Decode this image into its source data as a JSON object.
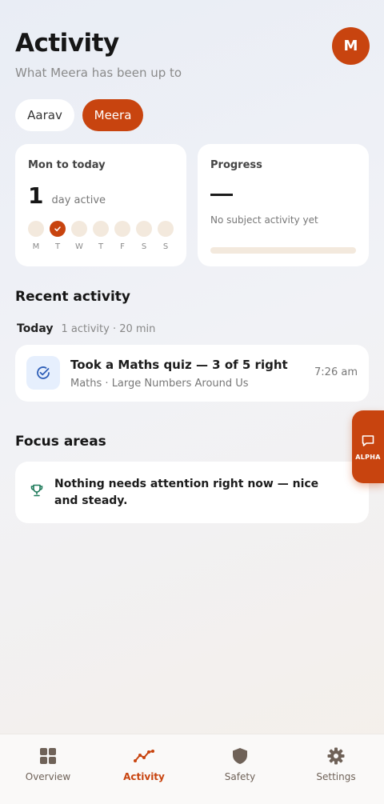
{
  "header": {
    "title": "Activity",
    "subtitle": "What Meera has been up to",
    "avatar_initial": "M"
  },
  "children": [
    {
      "name": "Aarav",
      "selected": false
    },
    {
      "name": "Meera",
      "selected": true
    }
  ],
  "week_card": {
    "label": "Mon to today",
    "days_active": "1",
    "days_active_text": "day active",
    "days": [
      {
        "letter": "M",
        "done": false
      },
      {
        "letter": "T",
        "done": true
      },
      {
        "letter": "W",
        "done": false
      },
      {
        "letter": "T",
        "done": false
      },
      {
        "letter": "F",
        "done": false
      },
      {
        "letter": "S",
        "done": false
      },
      {
        "letter": "S",
        "done": false
      }
    ]
  },
  "progress_card": {
    "label": "Progress",
    "note": "No subject activity yet",
    "fraction": 0
  },
  "recent": {
    "title": "Recent activity",
    "group_label": "Today",
    "group_meta": "1 activity · 20 min",
    "items": [
      {
        "title": "Took a Maths quiz — 3 of 5 right",
        "subtitle": "Maths · Large Numbers Around Us",
        "time": "7:26 am",
        "icon": "check-circle-icon"
      }
    ]
  },
  "focus": {
    "title": "Focus areas",
    "message": "Nothing needs attention right now — nice and steady.",
    "icon": "trophy-icon"
  },
  "alpha_button": {
    "label": "ALPHA",
    "icon": "chat-bubble-icon"
  },
  "nav": {
    "items": [
      {
        "label": "Overview",
        "icon": "grid-icon",
        "active": false
      },
      {
        "label": "Activity",
        "icon": "trend-icon",
        "active": true
      },
      {
        "label": "Safety",
        "icon": "shield-icon",
        "active": false
      },
      {
        "label": "Settings",
        "icon": "gear-icon",
        "active": false
      }
    ]
  },
  "colors": {
    "accent": "#c8440f",
    "muted_fill": "#f3e9dd",
    "icon_blue": "#2f5fb8",
    "icon_green": "#1e7a5a",
    "nav_icon": "#6f6258"
  }
}
